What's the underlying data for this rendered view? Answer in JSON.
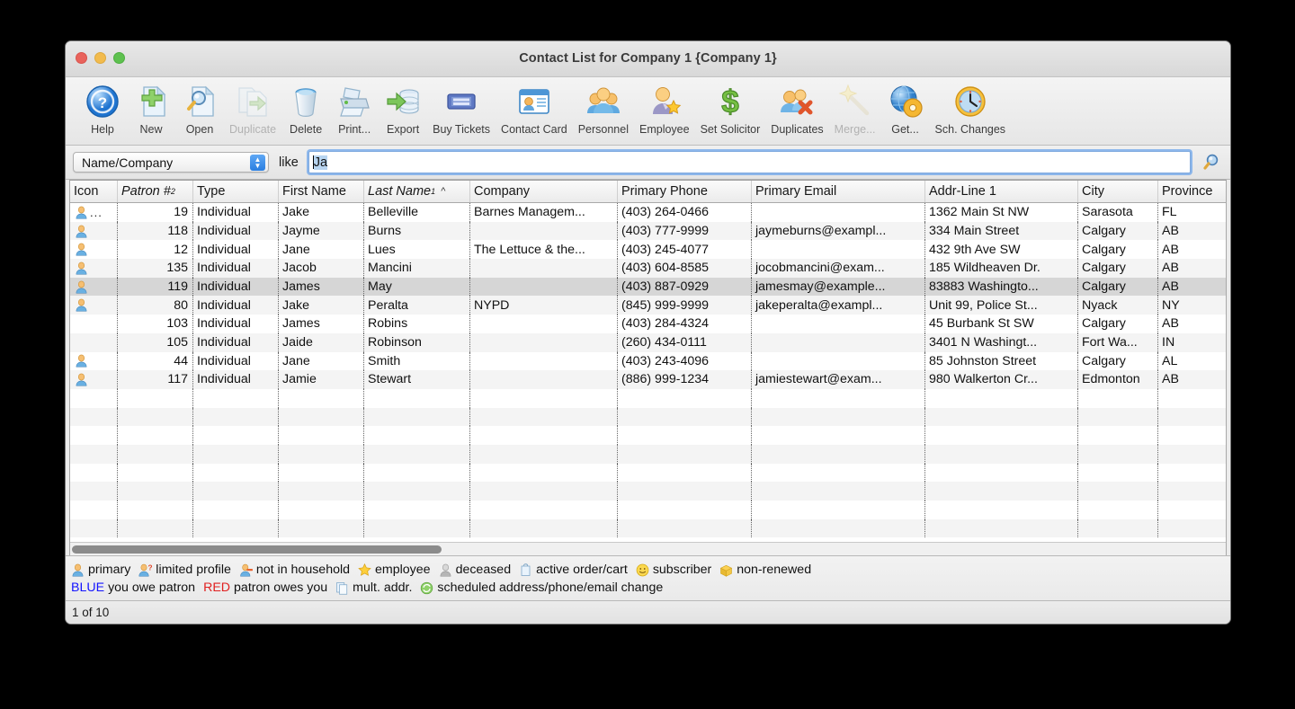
{
  "window": {
    "title": "Contact List for Company 1 {Company 1}",
    "traffic_lights": [
      "close",
      "minimize",
      "zoom"
    ]
  },
  "toolbar": {
    "items": [
      {
        "label": "Help",
        "icon": "help-icon",
        "disabled": false
      },
      {
        "label": "New",
        "icon": "new-document-icon",
        "disabled": false
      },
      {
        "label": "Open",
        "icon": "open-magnifier-icon",
        "disabled": false
      },
      {
        "label": "Duplicate",
        "icon": "duplicate-icon",
        "disabled": true
      },
      {
        "label": "Delete",
        "icon": "trash-icon",
        "disabled": false
      },
      {
        "label": "Print...",
        "icon": "printer-icon",
        "disabled": false
      },
      {
        "label": "Export",
        "icon": "export-database-icon",
        "disabled": false
      },
      {
        "label": "Buy Tickets",
        "icon": "ticket-icon",
        "disabled": false
      },
      {
        "label": "Contact Card",
        "icon": "contact-card-icon",
        "disabled": false
      },
      {
        "label": "Personnel",
        "icon": "people-group-icon",
        "disabled": false
      },
      {
        "label": "Employee",
        "icon": "person-star-icon",
        "disabled": false
      },
      {
        "label": "Set Solicitor",
        "icon": "dollar-icon",
        "disabled": false
      },
      {
        "label": "Duplicates",
        "icon": "people-x-icon",
        "disabled": false
      },
      {
        "label": "Merge...",
        "icon": "magic-wand-icon",
        "disabled": true
      },
      {
        "label": "Get...",
        "icon": "globe-gear-icon",
        "disabled": false
      },
      {
        "label": "Sch. Changes",
        "icon": "clock-icon",
        "disabled": false
      }
    ]
  },
  "search": {
    "field_selected": "Name/Company",
    "field_options": [
      "Name/Company"
    ],
    "operator_label": "like",
    "query_value": "Ja",
    "query_placeholder": "",
    "search_icon": "magnifier-icon"
  },
  "table": {
    "columns": [
      {
        "key": "icon",
        "label": "Icon",
        "width": 53,
        "italic": false,
        "sup": "",
        "sorted": false
      },
      {
        "key": "patron",
        "label": "Patron #",
        "width": 84,
        "italic": true,
        "sup": "2",
        "sorted": false,
        "align": "right"
      },
      {
        "key": "type",
        "label": "Type",
        "width": 95,
        "italic": false,
        "sup": "",
        "sorted": false
      },
      {
        "key": "first",
        "label": "First Name",
        "width": 95,
        "italic": false,
        "sup": "",
        "sorted": false
      },
      {
        "key": "last",
        "label": "Last Name",
        "width": 118,
        "italic": true,
        "sup": "1",
        "sorted": true,
        "sort_dir": "^"
      },
      {
        "key": "company",
        "label": "Company",
        "width": 164,
        "italic": false,
        "sup": "",
        "sorted": false
      },
      {
        "key": "phone",
        "label": "Primary Phone",
        "width": 149,
        "italic": false,
        "sup": "",
        "sorted": false
      },
      {
        "key": "email",
        "label": "Primary Email",
        "width": 193,
        "italic": false,
        "sup": "",
        "sorted": false
      },
      {
        "key": "addr",
        "label": "Addr-Line 1",
        "width": 170,
        "italic": false,
        "sup": "",
        "sorted": false
      },
      {
        "key": "city",
        "label": "City",
        "width": 89,
        "italic": false,
        "sup": "",
        "sorted": false
      },
      {
        "key": "province",
        "label": "Province",
        "width": 75,
        "italic": false,
        "sup": "",
        "sorted": false
      }
    ],
    "rows": [
      {
        "icon": "primary-person-icon",
        "trailing": "...",
        "patron": "19",
        "type": "Individual",
        "first": "Jake",
        "last": "Belleville",
        "company": "Barnes Managem...",
        "phone": "(403) 264-0466",
        "email": "",
        "addr": "1362 Main St NW",
        "city": "Sarasota",
        "province": "FL",
        "selected": false
      },
      {
        "icon": "primary-person-icon",
        "trailing": "",
        "patron": "118",
        "type": "Individual",
        "first": "Jayme",
        "last": "Burns",
        "company": "",
        "phone": "(403) 777-9999",
        "email": "jaymeburns@exampl...",
        "addr": "334 Main Street",
        "city": "Calgary",
        "province": "AB",
        "selected": false
      },
      {
        "icon": "primary-person-icon",
        "trailing": "",
        "patron": "12",
        "type": "Individual",
        "first": "Jane",
        "last": "Lues",
        "company": "The Lettuce & the...",
        "phone": "(403) 245-4077",
        "email": "",
        "addr": "432 9th Ave SW",
        "city": "Calgary",
        "province": "AB",
        "selected": false
      },
      {
        "icon": "primary-person-icon",
        "trailing": "",
        "patron": "135",
        "type": "Individual",
        "first": "Jacob",
        "last": "Mancini",
        "company": "",
        "phone": "(403) 604-8585",
        "email": "jocobmancini@exam...",
        "addr": "185 Wildheaven Dr.",
        "city": "Calgary",
        "province": "AB",
        "selected": false
      },
      {
        "icon": "primary-person-icon",
        "trailing": "",
        "patron": "119",
        "type": "Individual",
        "first": "James",
        "last": "May",
        "company": "",
        "phone": "(403) 887-0929",
        "email": "jamesmay@example...",
        "addr": "83883 Washingto...",
        "city": "Calgary",
        "province": "AB",
        "selected": true
      },
      {
        "icon": "primary-person-icon",
        "trailing": "",
        "patron": "80",
        "type": "Individual",
        "first": "Jake",
        "last": "Peralta",
        "company": "NYPD",
        "phone": "(845) 999-9999",
        "email": "jakeperalta@exampl...",
        "addr": "Unit 99, Police St...",
        "city": "Nyack",
        "province": "NY",
        "selected": false
      },
      {
        "icon": "",
        "trailing": "",
        "patron": "103",
        "type": "Individual",
        "first": "James",
        "last": "Robins",
        "company": "",
        "phone": "(403) 284-4324",
        "email": "",
        "addr": "45 Burbank St SW",
        "city": "Calgary",
        "province": "AB",
        "selected": false
      },
      {
        "icon": "",
        "trailing": "",
        "patron": "105",
        "type": "Individual",
        "first": "Jaide",
        "last": "Robinson",
        "company": "",
        "phone": "(260) 434-0111",
        "email": "",
        "addr": "3401 N Washingt...",
        "city": "Fort Wa...",
        "province": "IN",
        "selected": false
      },
      {
        "icon": "primary-person-icon",
        "trailing": "",
        "patron": "44",
        "type": "Individual",
        "first": "Jane",
        "last": "Smith",
        "company": "",
        "phone": "(403) 243-4096",
        "email": "",
        "addr": "85 Johnston Street",
        "city": "Calgary",
        "province": "AL",
        "selected": false
      },
      {
        "icon": "primary-person-icon",
        "trailing": "",
        "patron": "117",
        "type": "Individual",
        "first": "Jamie",
        "last": "Stewart",
        "company": "",
        "phone": "(886) 999-1234",
        "email": "jamiestewart@exam...",
        "addr": "980 Walkerton Cr...",
        "city": "Edmonton",
        "province": "AB",
        "selected": false
      }
    ],
    "empty_rows": 8,
    "scrollbar": {
      "orientation": "horizontal",
      "thumb_fraction": 0.32
    }
  },
  "legend": {
    "line1": [
      {
        "icon": "primary-person-icon",
        "text": "primary"
      },
      {
        "icon": "limited-profile-icon",
        "text": "limited profile"
      },
      {
        "icon": "not-in-household-icon",
        "text": "not in household"
      },
      {
        "icon": "employee-star-icon",
        "text": "employee"
      },
      {
        "icon": "deceased-person-icon",
        "text": "deceased"
      },
      {
        "icon": "active-order-cart-icon",
        "text": "active order/cart"
      },
      {
        "icon": "subscriber-smiley-icon",
        "text": "subscriber"
      },
      {
        "icon": "non-renewed-box-icon",
        "text": "non-renewed"
      }
    ],
    "line2": [
      {
        "icon": "",
        "badge": "BLUE",
        "badge_color": "#1414ff",
        "text": "you owe patron"
      },
      {
        "icon": "",
        "badge": "RED",
        "badge_color": "#e02020",
        "text": "patron owes you"
      },
      {
        "icon": "multiple-address-icon",
        "badge": "",
        "text": "mult. addr."
      },
      {
        "icon": "scheduled-change-icon",
        "badge": "",
        "text": "scheduled address/phone/email change"
      }
    ]
  },
  "status": {
    "text": "1 of 10"
  },
  "colors": {
    "accent_blue": "#2a7ee0",
    "selection_gray": "#d6d6d6",
    "alt_row": "#f4f4f4",
    "legend_blue": "#1414ff",
    "legend_red": "#e02020"
  }
}
